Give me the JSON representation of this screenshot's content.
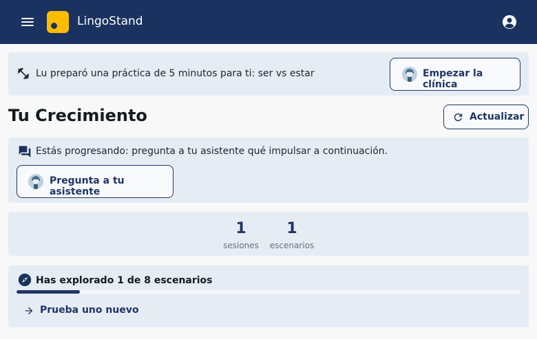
{
  "app": {
    "title": "LingoStand"
  },
  "icons": {
    "menu": "hamburger-icon",
    "account": "account-circle-icon",
    "practice": "fitness-icon",
    "assistant": "assistant-avatar-icon",
    "refresh": "refresh-icon",
    "chat": "chat-bubbles-icon",
    "explore": "compass-icon",
    "go": "arrow-right-icon"
  },
  "colors": {
    "topbar": "#19325f",
    "logo": "#ffbd00",
    "accent": "#1f3564",
    "card": "#e6ecf4"
  },
  "banner": {
    "text": "Lu preparó una práctica de 5 minutos para ti: ser vs estar",
    "button": "Empezar la clínica"
  },
  "growth": {
    "title": "Tu Crecimiento",
    "refresh_label": "Actualizar"
  },
  "insight": {
    "text": "Estás progresando: pregunta a tu asistente qué impulsar a continuación.",
    "button": "Pregunta a tu asistente"
  },
  "stats": [
    {
      "value": "1",
      "label": "sesiones"
    },
    {
      "value": "1",
      "label": "escenarios"
    }
  ],
  "explore": {
    "text": "Has explorado 1 de 8 escenarios",
    "explored": 1,
    "total": 8,
    "action": "Prueba uno nuevo"
  }
}
